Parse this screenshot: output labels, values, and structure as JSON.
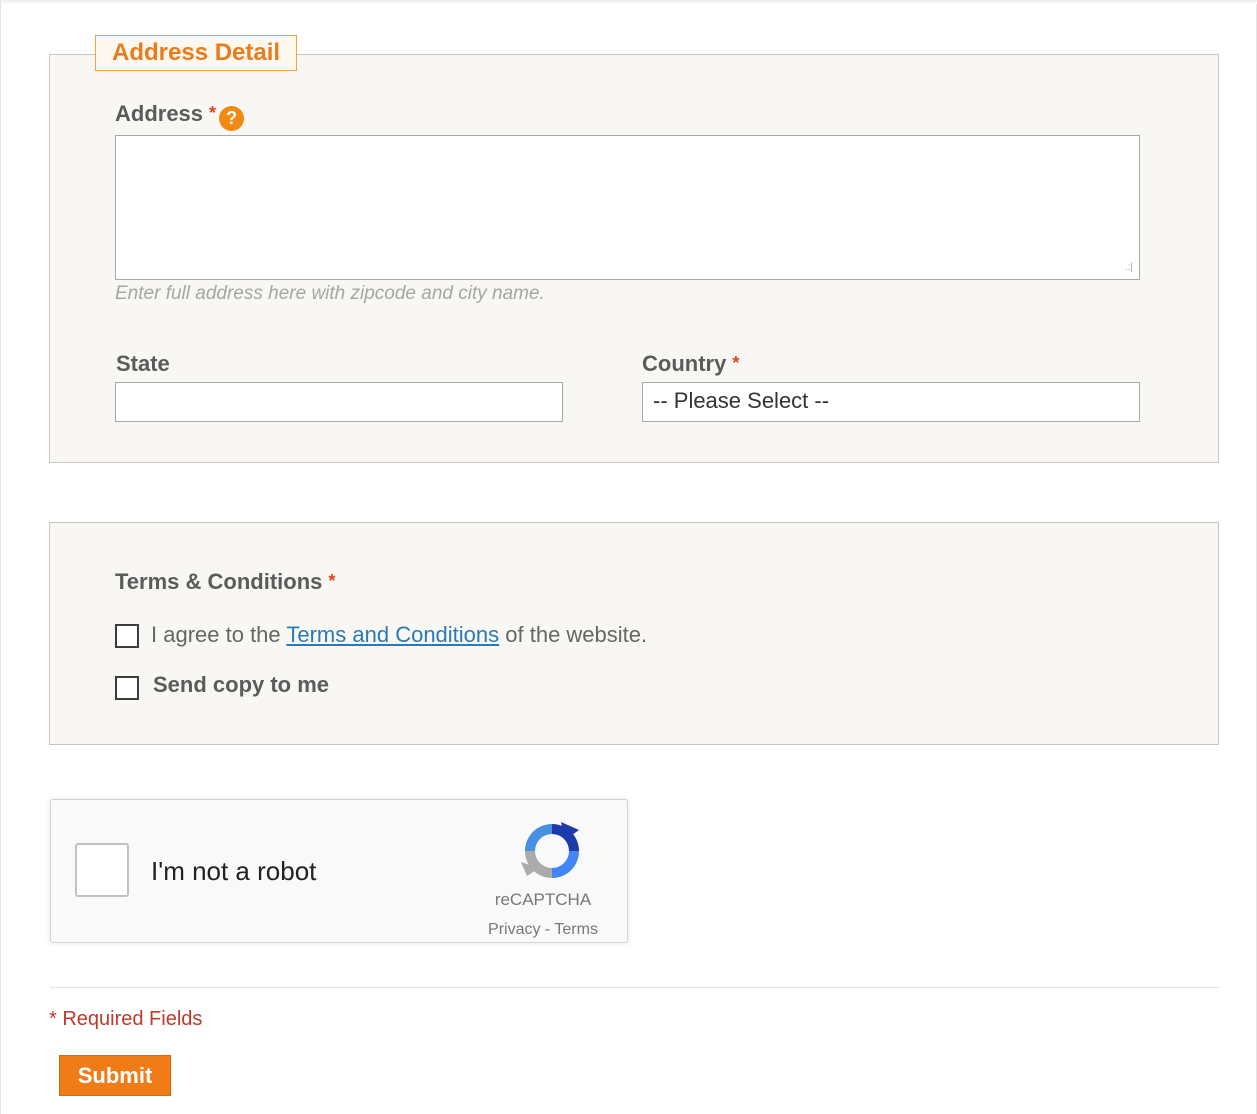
{
  "address_section": {
    "legend": "Address Detail",
    "address_label": "Address",
    "required_mark": "*",
    "help_icon": "question-circle-icon",
    "address_value": "",
    "address_hint": "Enter full address here with zipcode and city name.",
    "state_label": "State",
    "state_value": "",
    "country_label": "Country",
    "country_selected": "-- Please Select --"
  },
  "terms_section": {
    "label": "Terms & Conditions",
    "required_mark": "*",
    "agree_prefix": "I agree to the ",
    "agree_link": "Terms and Conditions",
    "agree_suffix": " of the website.",
    "agree_checked": false,
    "send_copy_label": "Send copy to me",
    "send_copy_checked": false
  },
  "recaptcha": {
    "label": "I'm not a robot",
    "brand": "reCAPTCHA",
    "privacy": "Privacy",
    "separator": " - ",
    "terms": "Terms",
    "checked": false
  },
  "footer": {
    "required_note": "* Required Fields",
    "submit_label": "Submit"
  },
  "colors": {
    "accent": "#ef7c16",
    "legend_text": "#e87c1e",
    "required": "#e0441b",
    "link": "#2a7ab8",
    "panel_bg": "#f8f7f4"
  }
}
